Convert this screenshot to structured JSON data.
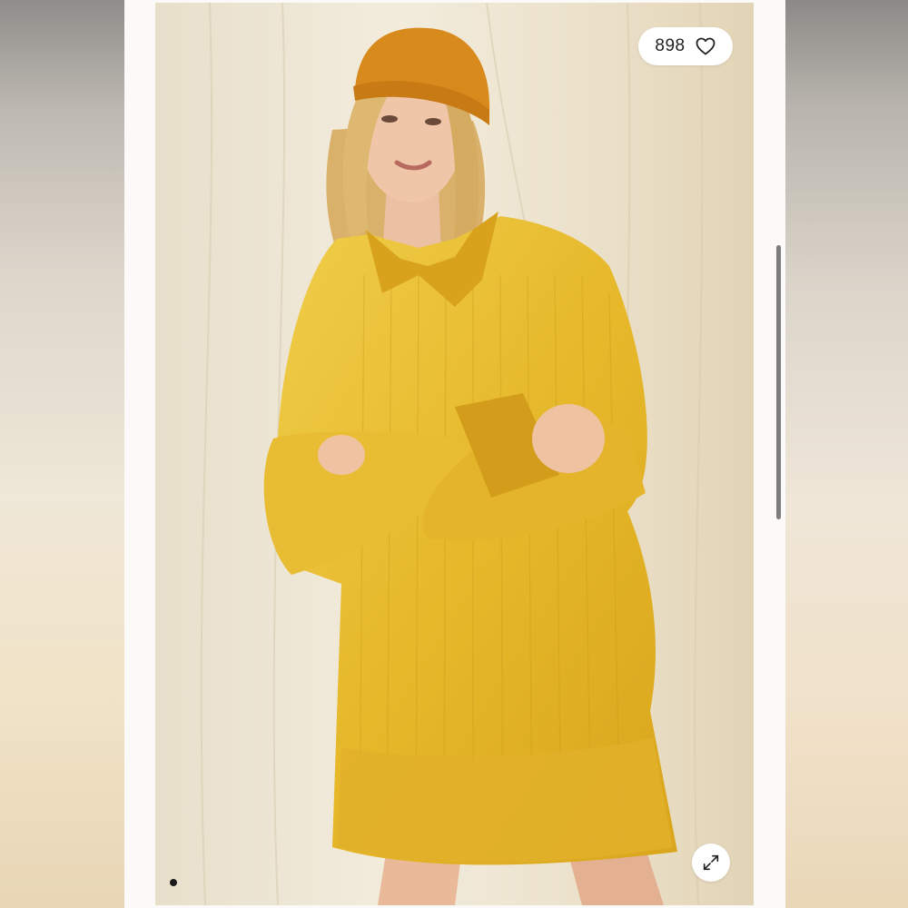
{
  "listing": {
    "likes_count": "898",
    "like_icon": "heart-outline-icon",
    "expand_icon": "expand-arrows-icon",
    "image_pagination": {
      "current": 1,
      "total": 1
    }
  },
  "colors": {
    "sweater": "#e8b92a",
    "beanie": "#d98a1d",
    "backdrop": "#eee6d3"
  }
}
